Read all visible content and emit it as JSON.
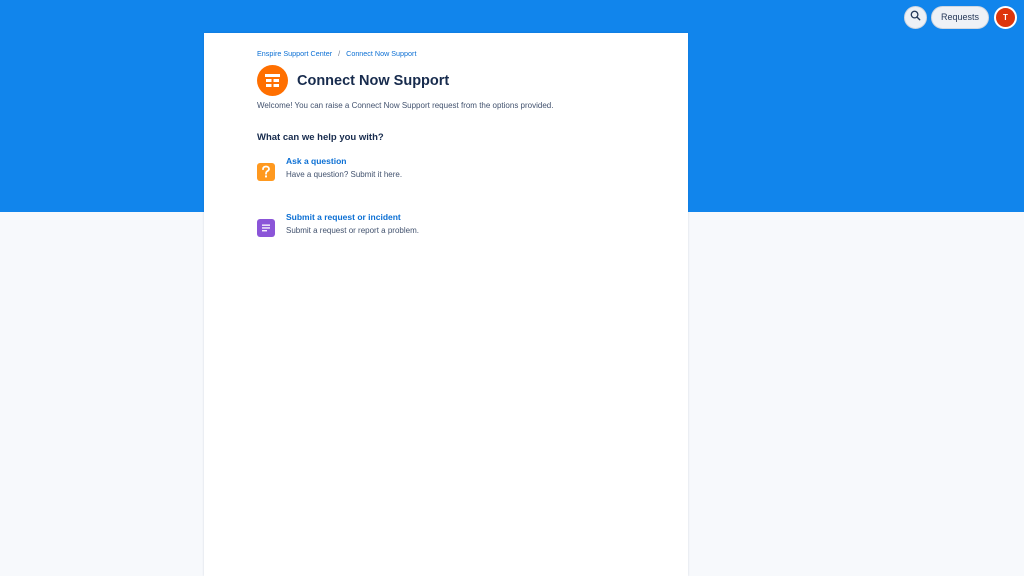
{
  "topbar": {
    "search_icon": "search-icon",
    "requests_label": "Requests",
    "avatar_initial": "T",
    "avatar_color": "#de350b"
  },
  "banner": {
    "color": "#1185ec"
  },
  "breadcrumb": {
    "items": [
      "Enspire Support Center",
      "Connect Now Support"
    ],
    "separator": "/"
  },
  "portal": {
    "title": "Connect Now Support",
    "logo_icon": "portal-logo-icon",
    "logo_color": "#ff6f00",
    "welcome": "Welcome! You can raise a Connect Now Support request from the options provided."
  },
  "help": {
    "heading": "What can we help you with?",
    "options": [
      {
        "title": "Ask a question",
        "description": "Have a question? Submit it here.",
        "icon": "question-icon",
        "icon_color": "#ff991f"
      },
      {
        "title": "Submit a request or incident",
        "description": "Submit a request or report a problem.",
        "icon": "document-icon",
        "icon_color": "#8b55d8"
      }
    ]
  }
}
